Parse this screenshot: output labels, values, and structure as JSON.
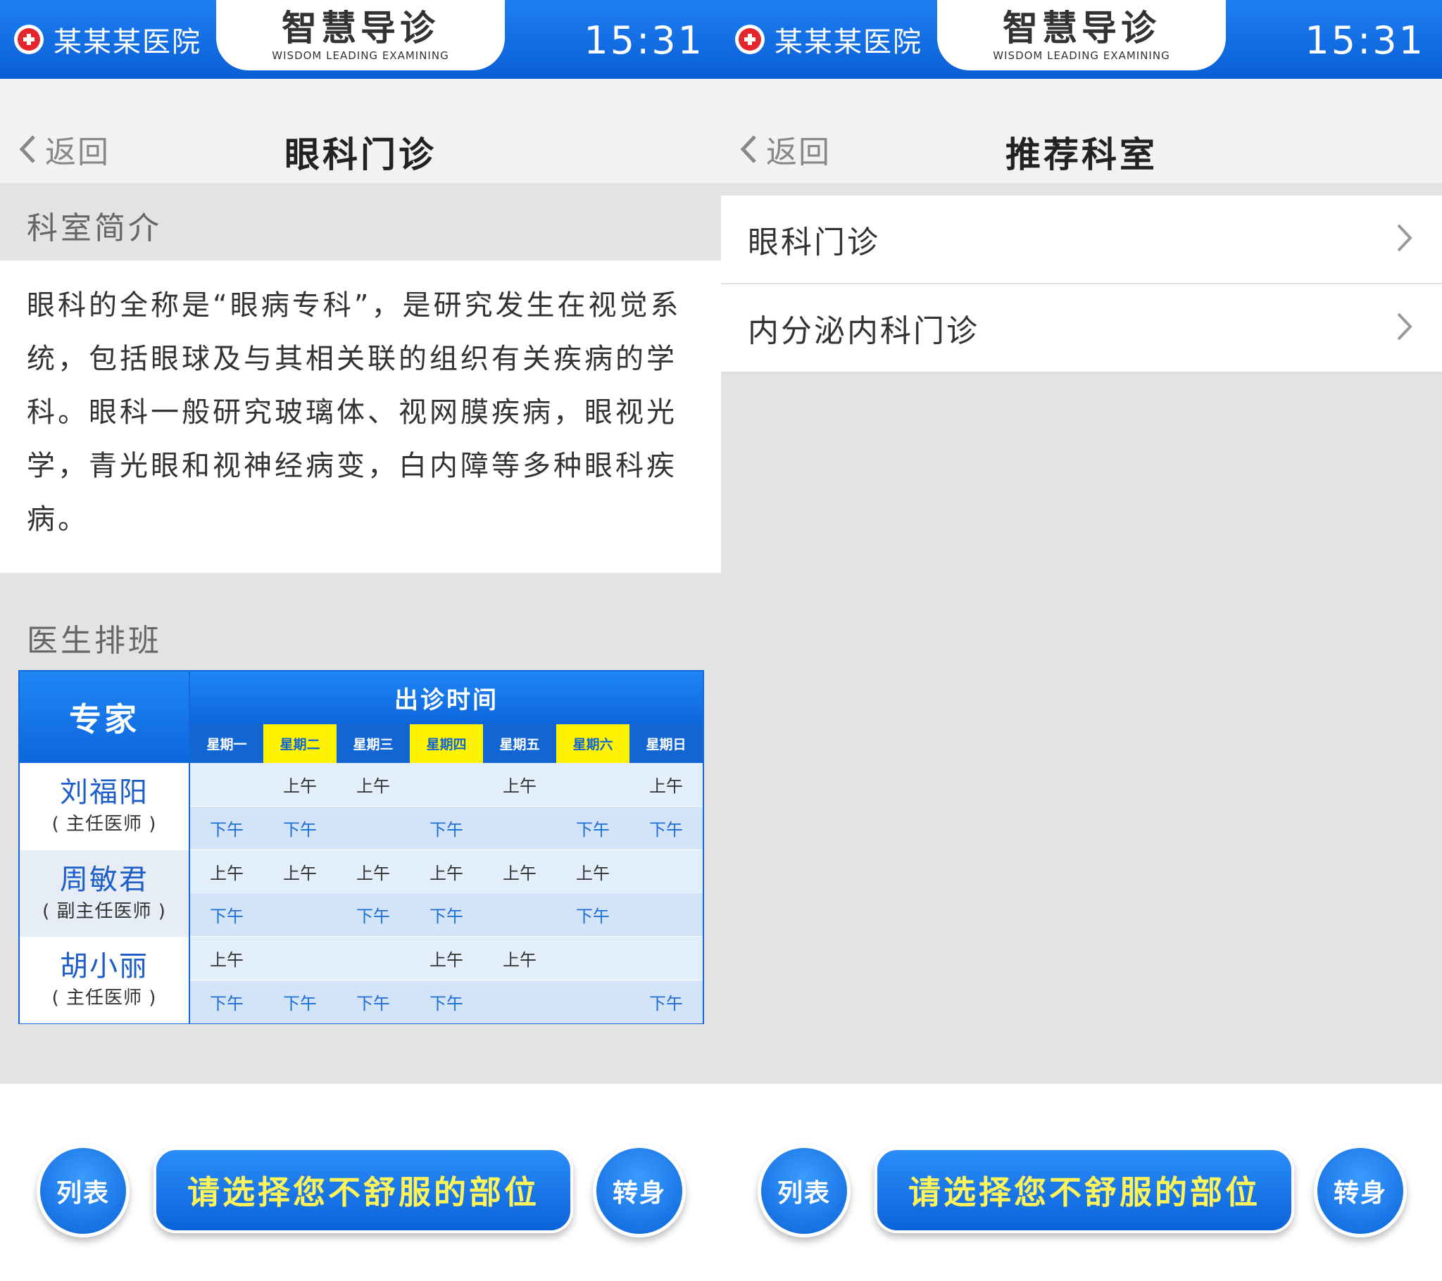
{
  "header": {
    "hospital_name": "某某某医院",
    "title": "智慧导诊",
    "subtitle": "WISDOM LEADING EXAMINING",
    "time": "15:31"
  },
  "colors": {
    "brand_blue": "#0a5fd6",
    "highlight_yellow": "#fff300",
    "plus_red": "#e5252c"
  },
  "left_screen": {
    "back_label": "返回",
    "nav_title": "眼科门诊",
    "intro_heading": "科室简介",
    "intro_text": "眼科的全称是“眼病专科”，是研究发生在视觉系统，包括眼球及与其相关联的组织有关疾病的学科。眼科一般研究玻璃体、视网膜疾病，眼视光学，青光眼和视神经病变，白内障等多种眼科疾病。",
    "schedule_heading": "医生排班",
    "schedule": {
      "expert_header": "专家",
      "time_header": "出诊时间",
      "days": [
        "星期一",
        "星期二",
        "星期三",
        "星期四",
        "星期五",
        "星期六",
        "星期日"
      ],
      "highlighted_days": [
        1,
        3,
        5
      ],
      "doctors": [
        {
          "name": "刘福阳",
          "title": "( 主任医师 )",
          "am": [
            "",
            "上午",
            "上午",
            "",
            "上午",
            "",
            "上午"
          ],
          "pm": [
            "下午",
            "下午",
            "",
            "下午",
            "",
            "下午",
            "下午"
          ]
        },
        {
          "name": "周敏君",
          "title": "( 副主任医师 )",
          "am": [
            "上午",
            "上午",
            "上午",
            "上午",
            "上午",
            "上午",
            ""
          ],
          "pm": [
            "下午",
            "",
            "下午",
            "下午",
            "",
            "下午",
            ""
          ]
        },
        {
          "name": "胡小丽",
          "title": "( 主任医师 )",
          "am": [
            "上午",
            "",
            "",
            "上午",
            "上午",
            "",
            ""
          ],
          "pm": [
            "下午",
            "下午",
            "下午",
            "下午",
            "",
            "",
            "下午"
          ]
        }
      ]
    }
  },
  "right_screen": {
    "back_label": "返回",
    "nav_title": "推荐科室",
    "items": [
      {
        "label": "眼科门诊"
      },
      {
        "label": "内分泌内科门诊"
      }
    ]
  },
  "bottom_bar": {
    "list_button": "列表",
    "select_button": "请选择您不舒服的部位",
    "turn_button": "转身"
  }
}
